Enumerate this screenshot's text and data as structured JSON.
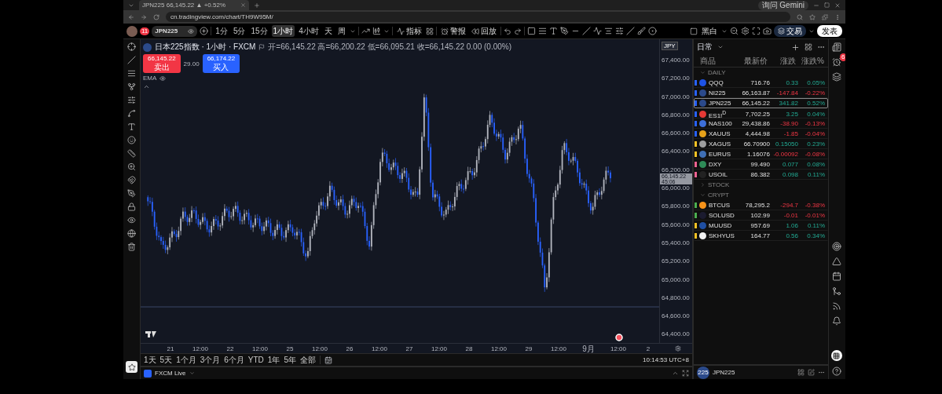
{
  "browser": {
    "tab": {
      "title": "JPN225 66,145.22 ▲ +0.52%",
      "selected": true
    },
    "gemini_button": "询问 Gemini",
    "url": "cn.tradingview.com/chart/TH9W95M/"
  },
  "toolbar": {
    "avatar_badge": "11",
    "symbol": "JPN225",
    "intervals": [
      {
        "label": "1分",
        "selected": false
      },
      {
        "label": "5分",
        "selected": false
      },
      {
        "label": "15分",
        "selected": false
      },
      {
        "label": "1小时",
        "selected": true
      },
      {
        "label": "4小时",
        "selected": false
      },
      {
        "label": "天",
        "selected": false
      },
      {
        "label": "周",
        "selected": false
      }
    ],
    "indicators": "指标",
    "alert": "警报",
    "replay": "回放",
    "theme": "黑白",
    "trade": "交易",
    "publish": "发表"
  },
  "chart": {
    "title": "日本225指数 · 1小时 · FXCM",
    "ohlc": "开=66,145.22 高=66,200.22 低=66,095.21 收=66,145.22 0.00 (0.00%)",
    "sell": {
      "price": "66,145.22",
      "label": "卖出"
    },
    "spread": "29.00",
    "buy": {
      "price": "66,174.22",
      "label": "买入"
    },
    "indicator": "EMA",
    "currency": "JPY",
    "price_labels": [
      "67,400.00",
      "67,200.00",
      "67,000.00",
      "66,800.00",
      "66,600.00",
      "66,400.00",
      "66,200.00",
      "66,000.00",
      "65,800.00",
      "65,600.00",
      "65,400.00",
      "65,200.00",
      "65,000.00",
      "64,800.00",
      "64,600.00",
      "64,400.00"
    ],
    "current_price": {
      "price": "66,145.22",
      "countdown": "45:06"
    },
    "time_labels": [
      "21",
      "12:00",
      "22",
      "12:00",
      "25",
      "12:00",
      "26",
      "12:00",
      "27",
      "12:00",
      "28",
      "12:00",
      "29",
      "12:00",
      "9月",
      "12:00",
      "2"
    ]
  },
  "ranges": [
    {
      "label": "1天"
    },
    {
      "label": "5天"
    },
    {
      "label": "1个月"
    },
    {
      "label": "3个月"
    },
    {
      "label": "6个月"
    },
    {
      "label": "YTD"
    },
    {
      "label": "1年"
    },
    {
      "label": "5年"
    },
    {
      "label": "全部"
    }
  ],
  "clock": "10:14:53 UTC+8",
  "broker": "FXCM Live",
  "watchlist": {
    "title": "日常",
    "columns": [
      "商品",
      "最新价",
      "涨跌",
      "涨跌%"
    ],
    "sections": [
      {
        "title": "DAILY",
        "expanded": true,
        "rows": [
          {
            "symbol": "QQQ",
            "price": "716.76",
            "change": "0.33",
            "change_pct": "0.05%",
            "rising": true,
            "color": "#2962ff",
            "badge": {
              "color": "#1e53e5"
            },
            "selected": false
          },
          {
            "symbol": "NI225",
            "price": "66,163.87",
            "change": "-147.84",
            "change_pct": "-0.22%",
            "rising": false,
            "color": "#2962ff",
            "badge": {
              "color": "#2b4a8b"
            },
            "selected": false
          },
          {
            "symbol": "JPN225",
            "price": "66,145.22",
            "change": "341.82",
            "change_pct": "0.52%",
            "rising": true,
            "color": "#2962ff",
            "badge": {
              "color": "#2b4a8b"
            },
            "selected": true
          },
          {
            "symbol": "ES1!$^{D}$",
            "price": "7,702.25",
            "change": "3.25",
            "change_pct": "0.04%",
            "rising": true,
            "color": "#2962ff",
            "badge": {
              "color": "#e53935"
            },
            "selected": false
          },
          {
            "symbol": "NAS100",
            "price": "29,438.86",
            "change": "-38.90",
            "change_pct": "-0.13%",
            "rising": false,
            "color": "#2962ff",
            "badge": {
              "color": "#3d6fd8"
            },
            "selected": false
          },
          {
            "symbol": "XAUUS",
            "price": "4,444.98",
            "change": "-1.85",
            "change_pct": "-0.04%",
            "rising": false,
            "color": "#2962ff",
            "badge": {
              "color": "#e6a21a"
            },
            "selected": false
          },
          {
            "symbol": "XAGUS",
            "price": "66.70900",
            "change": "0.15050",
            "change_pct": "0.23%",
            "rising": true,
            "color": "#f7c325",
            "badge": {
              "color": "#9e9e9e"
            },
            "selected": false
          },
          {
            "symbol": "EURUS",
            "price": "1.16076",
            "change": "-0.00092",
            "change_pct": "-0.08%",
            "rising": false,
            "color": "#f7c325",
            "badge": {
              "color": "#3f6fb5"
            },
            "selected": false
          },
          {
            "symbol": "DXY",
            "price": "99.490",
            "change": "0.077",
            "change_pct": "0.08%",
            "rising": true,
            "color": "#f06292",
            "badge": {
              "color": "#2e8b57"
            },
            "selected": false
          },
          {
            "symbol": "USOIL",
            "price": "86.382",
            "change": "0.098",
            "change_pct": "0.11%",
            "rising": true,
            "color": "#f06292",
            "badge": {
              "color": "#222222"
            },
            "selected": false
          }
        ]
      },
      {
        "title": "STOCK",
        "expanded": false
      },
      {
        "title": "CRYPT",
        "expanded": true,
        "rows": [
          {
            "symbol": "BTCUS",
            "price": "78,295.2",
            "change": "-294.7",
            "change_pct": "-0.38%",
            "rising": false,
            "color": "#4caf50",
            "badge": {
              "color": "#f7931a"
            },
            "selected": false
          },
          {
            "symbol": "SOLUSD",
            "price": "102.99",
            "change": "-0.01",
            "change_pct": "-0.01%",
            "rising": false,
            "color": "#4caf50",
            "badge": {
              "color": "#1b1b2f"
            },
            "selected": false
          },
          {
            "symbol": "MUUSD",
            "price": "957.69",
            "change": "1.06",
            "change_pct": "0.11%",
            "rising": true,
            "color": "#f7c325",
            "badge": {
              "color": "#1f4fa3"
            },
            "selected": false
          },
          {
            "symbol": "SKHYUS",
            "price": "164.77",
            "change": "0.56",
            "change_pct": "0.34%",
            "rising": true,
            "color": "#f7c325",
            "badge": {
              "color": "#f2f2f2"
            },
            "selected": false
          }
        ]
      }
    ]
  },
  "details": {
    "badge": "225",
    "symbol": "JPN225"
  },
  "alerts_badge": "6"
}
